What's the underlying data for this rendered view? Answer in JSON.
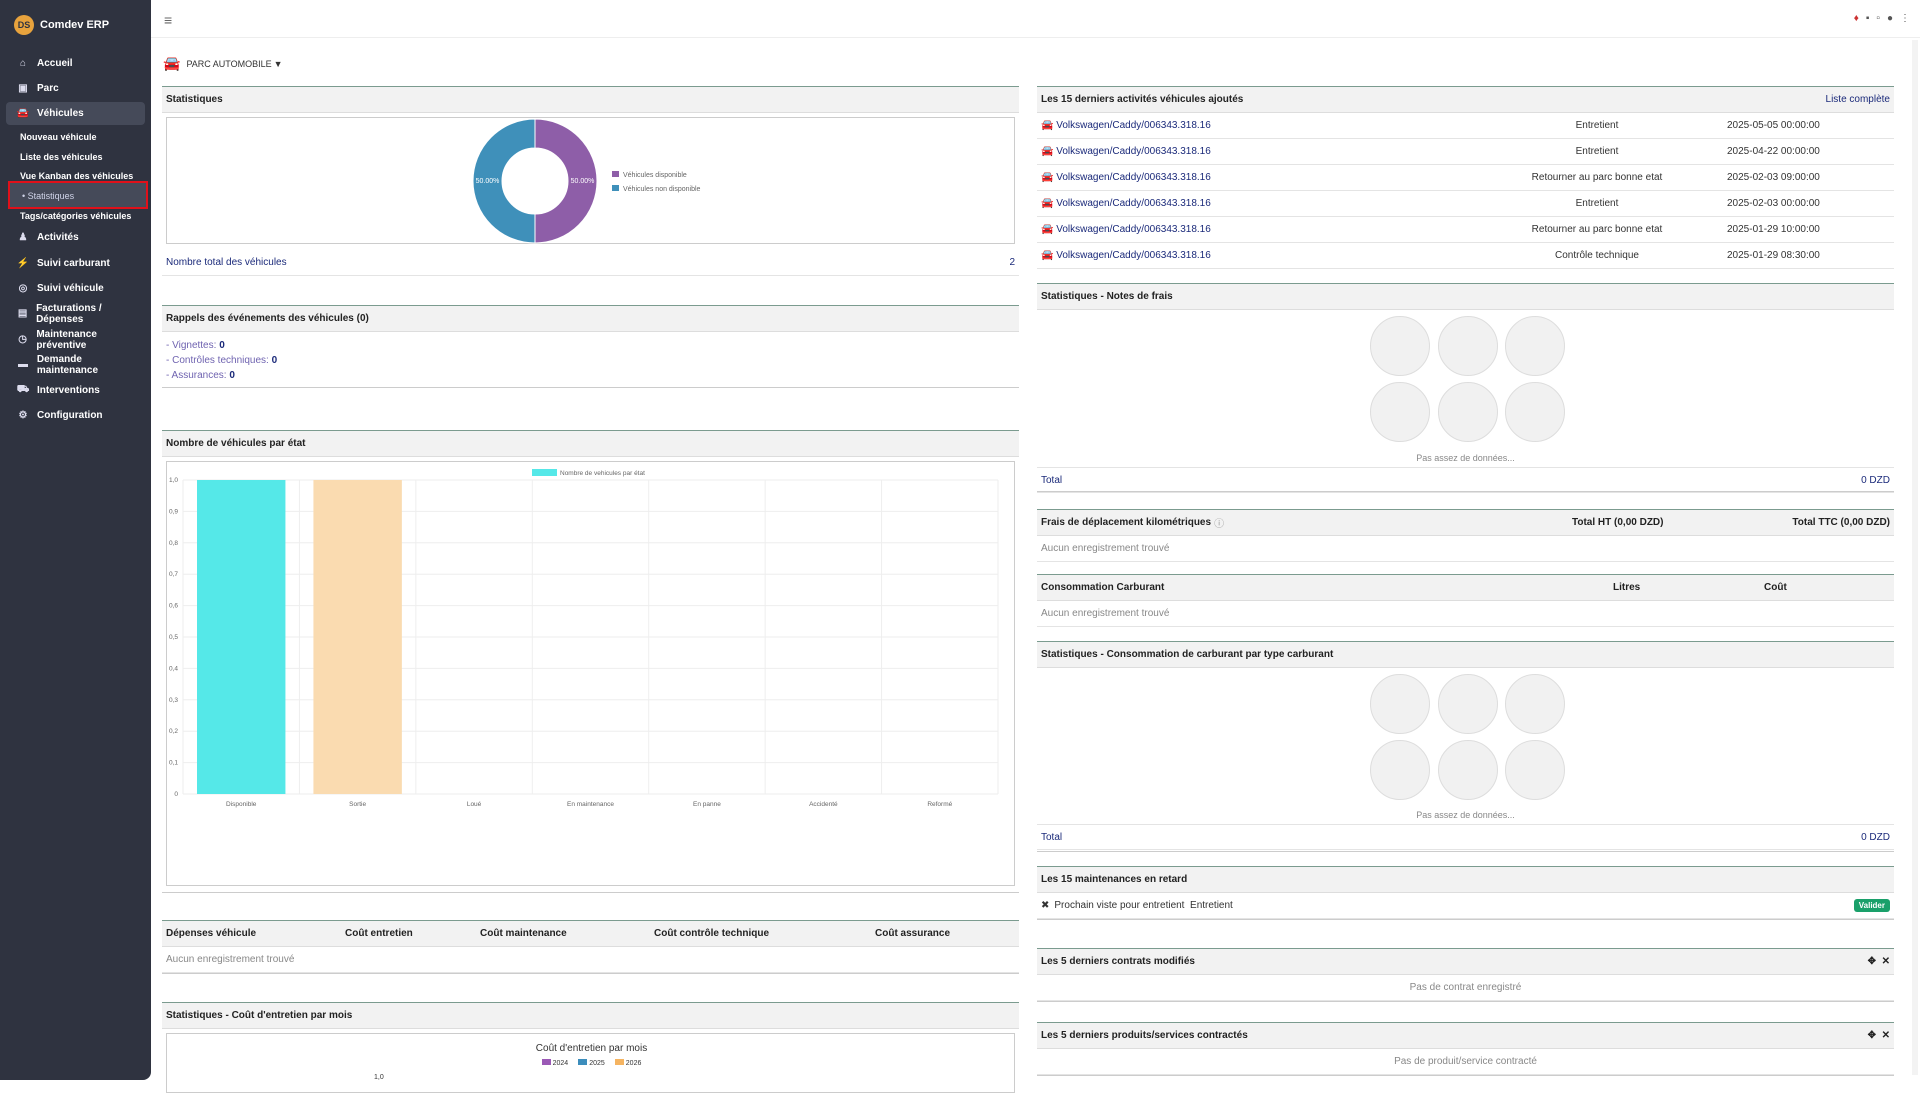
{
  "app": {
    "name": "Comdev ERP"
  },
  "sidebar": {
    "items": [
      {
        "label": "Accueil",
        "icon": "home-icon"
      },
      {
        "label": "Parc",
        "icon": "book-icon"
      },
      {
        "label": "Véhicules",
        "icon": "car-icon"
      },
      {
        "label": "Activités",
        "icon": "activities-icon"
      },
      {
        "label": "Suivi carburant",
        "icon": "fuel-icon"
      },
      {
        "label": "Suivi véhicule",
        "icon": "binoculars-icon"
      },
      {
        "label": "Facturations / Dépenses",
        "icon": "invoice-icon"
      },
      {
        "label": "Maintenance préventive",
        "icon": "clock-icon"
      },
      {
        "label": "Demande maintenance",
        "icon": "request-icon"
      },
      {
        "label": "Interventions",
        "icon": "truck-icon"
      },
      {
        "label": "Configuration",
        "icon": "cogs-icon"
      }
    ],
    "subitems": [
      "Nouveau véhicule",
      "Liste des véhicules",
      "Vue Kanban des véhicules",
      "Statistiques",
      "Tags/catégories véhicules"
    ]
  },
  "page": {
    "title": "PARC AUTOMOBILE"
  },
  "stats": {
    "header": "Statistiques",
    "pie": {
      "legend": [
        "Véhicules disponible",
        "Véhicules non disponible"
      ],
      "labels": [
        "50.00%",
        "50.00%"
      ]
    },
    "total_label": "Nombre total des véhicules",
    "total_value": "2"
  },
  "reminders": {
    "header": "Rappels des événements des véhicules (0)",
    "items": [
      {
        "label": "- Vignettes:",
        "value": "0"
      },
      {
        "label": "- Contrôles techniques:",
        "value": "0"
      },
      {
        "label": "- Assurances:",
        "value": "0"
      }
    ]
  },
  "bar_section": {
    "header": "Nombre de véhicules par état"
  },
  "chart_data": [
    {
      "type": "bar",
      "title": "",
      "legend": "Nombre de vehicules par état",
      "categories": [
        "Disponible",
        "Sortie",
        "Loué",
        "En maintenance",
        "En panne",
        "Accidenté",
        "Reformé"
      ],
      "values": [
        1,
        1,
        0,
        0,
        0,
        0,
        0
      ],
      "colors": [
        "#55e8e8",
        "#fadbb0",
        "#ccc",
        "#ccc",
        "#ccc",
        "#ccc",
        "#ccc"
      ],
      "ylim": [
        0,
        1
      ],
      "yticks": [
        "1,0",
        "0,9",
        "0,8",
        "0,7",
        "0,6",
        "0,5",
        "0,4",
        "0,3",
        "0,2",
        "0,1",
        "0"
      ]
    },
    {
      "type": "pie",
      "values": [
        50,
        50
      ],
      "labels": [
        "Véhicules disponible",
        "Véhicules non disponible"
      ],
      "colors": [
        "#8e5ea8",
        "#3f90ba"
      ]
    }
  ],
  "expenses": {
    "headers": [
      "Dépenses véhicule",
      "Coût entretien",
      "Coût maintenance",
      "Coût contrôle technique",
      "Coût assurance"
    ],
    "empty": "Aucun enregistrement trouvé"
  },
  "monthly": {
    "header": "Statistiques - Coût d'entretien par mois",
    "title": "Coût d'entretien par mois",
    "legend": [
      "2024",
      "2025",
      "2026"
    ],
    "ytop": "1,0"
  },
  "activities": {
    "header": "Les 15 derniers activités véhicules ajoutés",
    "link": "Liste complète",
    "rows": [
      {
        "vehicle": "Volkswagen/Caddy/006343.318.16",
        "type": "Entretient",
        "date": "2025-05-05 00:00:00"
      },
      {
        "vehicle": "Volkswagen/Caddy/006343.318.16",
        "type": "Entretient",
        "date": "2025-04-22 00:00:00"
      },
      {
        "vehicle": "Volkswagen/Caddy/006343.318.16",
        "type": "Retourner au parc bonne etat",
        "date": "2025-02-03 09:00:00"
      },
      {
        "vehicle": "Volkswagen/Caddy/006343.318.16",
        "type": "Entretient",
        "date": "2025-02-03 00:00:00"
      },
      {
        "vehicle": "Volkswagen/Caddy/006343.318.16",
        "type": "Retourner au parc bonne etat",
        "date": "2025-01-29 10:00:00"
      },
      {
        "vehicle": "Volkswagen/Caddy/006343.318.16",
        "type": "Contrôle technique",
        "date": "2025-01-29 08:30:00"
      }
    ]
  },
  "notes": {
    "header": "Statistiques - Notes de frais",
    "nodata": "Pas assez de données...",
    "total_label": "Total",
    "total_value": "0 DZD"
  },
  "mileage": {
    "header": "Frais de déplacement kilométriques",
    "ht": "Total HT (0,00 DZD)",
    "ttc": "Total TTC (0,00 DZD)",
    "empty": "Aucun enregistrement trouvé"
  },
  "fuel": {
    "header": "Consommation Carburant",
    "liters": "Litres",
    "cost": "Coût",
    "empty": "Aucun enregistrement trouvé"
  },
  "fuel_stats": {
    "header": "Statistiques - Consommation de carburant par type carburant",
    "nodata": "Pas assez de données...",
    "total_label": "Total",
    "total_value": "0 DZD"
  },
  "late": {
    "header": "Les 15 maintenances en retard",
    "item": "Prochain viste pour entretient",
    "type": "Entretient",
    "button": "Valider"
  },
  "contracts": {
    "header": "Les 5 derniers contrats modifiés",
    "empty": "Pas de contrat enregistré"
  },
  "products": {
    "header": "Les 5 derniers produits/services contractés",
    "empty": "Pas de produit/service contracté"
  }
}
